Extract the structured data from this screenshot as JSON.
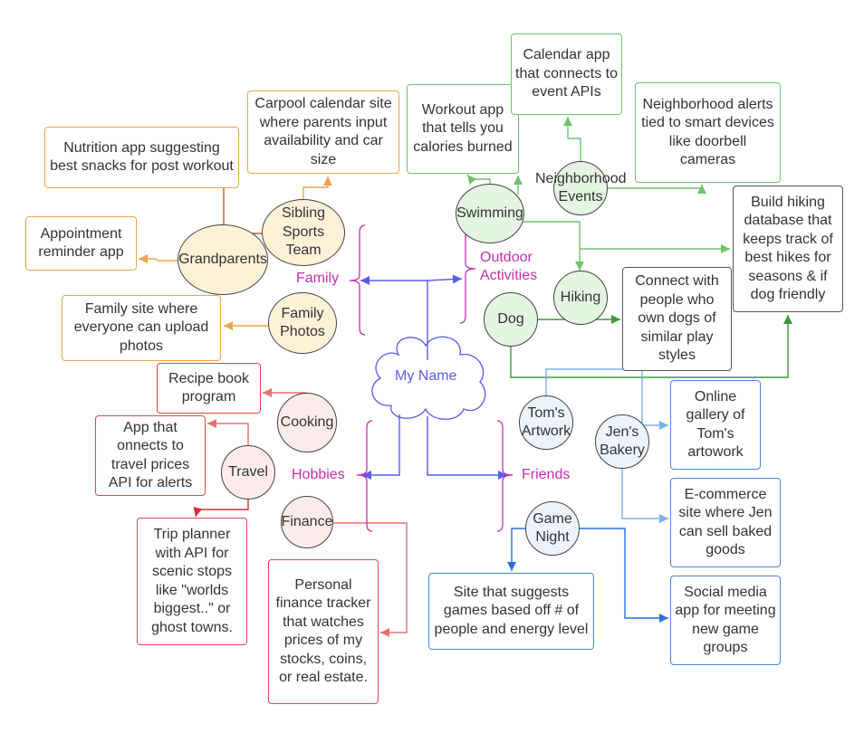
{
  "center": {
    "label": "My Name",
    "color": "#5b5bf0"
  },
  "categories": {
    "family": {
      "label": "Family"
    },
    "outdoor": {
      "label": "Outdoor Activities"
    },
    "hobbies": {
      "label": "Hobbies"
    },
    "friends": {
      "label": "Friends"
    }
  },
  "colors": {
    "category_label": "#c42fb0",
    "family_fill": "#fdf1d8",
    "family_border": "#f0a34a",
    "outdoor_fill": "#e4f5e1",
    "outdoor_border": "#6cc46c",
    "hobbies_fill": "#fbeceb",
    "hobbies_border": "#e04848",
    "friends_fill": "#edf3fc",
    "friends_border": "#4a84e0",
    "dark_box_border": "#555555"
  },
  "nodes": {
    "grandparents": "Grandparents",
    "sibling": "Sibling Sports Team",
    "familyPhotos": "Family Photos",
    "swimming": "Swimming",
    "neighborhood": "Neighborhood Events",
    "hiking": "Hiking",
    "dog": "Dog",
    "cooking": "Cooking",
    "travel": "Travel",
    "finance": "Finance",
    "toms": "Tom's Artwork",
    "jens": "Jen's Bakery",
    "gameNight": "Game Night"
  },
  "ideas": {
    "nutrition": "Nutrition app suggesting best snacks for post workout",
    "carpool": "Carpool calendar site where parents input availability and car size",
    "appointment": "Appointment reminder app",
    "familySite": "Family site where everyone can upload photos",
    "workout": "Workout app that tells you calories burned",
    "calendar": "Calendar app that connects to event APIs",
    "neighborhoodAlerts": "Neighborhood alerts tied to smart devices like doorbell cameras",
    "hikingDb": "Build hiking database that keeps track of best hikes for seasons & if dog friendly",
    "connectDogs": "Connect with people who own dogs of similar play styles",
    "recipe": "Recipe book program",
    "travelApp": "App that onnects to travel prices API for alerts",
    "trip": "Trip planner with API for scenic stops like \"worlds biggest..\" or ghost towns.",
    "financeTracker": "Personal finance tracker that watches prices of my stocks, coins, or real estate.",
    "onlineGallery": "Online gallery of Tom's artowork",
    "ecommerce": "E-commerce site where Jen can sell baked goods",
    "socialMedia": "Social media app for meeting new game groups",
    "siteGames": "Site that suggests games based off # of people and energy level"
  }
}
